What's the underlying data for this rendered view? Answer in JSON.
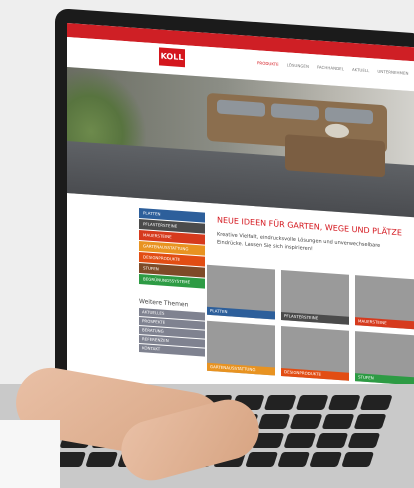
{
  "site": {
    "logo_text": "KOLL",
    "nav": [
      "PRODUKTE",
      "LÖSUNGEN",
      "FACHHANDEL",
      "AKTUELL",
      "UNTERNEHMEN"
    ],
    "active_nav_index": 0,
    "colors": {
      "brand": "#d4161d",
      "topbar": "#cf1f25",
      "sidebar_muted": "#7f8290"
    }
  },
  "sidebar": {
    "items": [
      {
        "label": "PLATTEN",
        "color": "#2d5f9b"
      },
      {
        "label": "PFLASTERSTEINE",
        "color": "#4b4b4b"
      },
      {
        "label": "MAUERSTEINE",
        "color": "#d63a1d"
      },
      {
        "label": "GARTENAUSSTATTUNG",
        "color": "#e89321"
      },
      {
        "label": "DESIGNPRODUKTE",
        "color": "#e24d13"
      },
      {
        "label": "STUFEN",
        "color": "#7e4a27"
      },
      {
        "label": "BEGRÜNUNGSSYSTEME",
        "color": "#2d9b44"
      }
    ]
  },
  "content": {
    "title": "NEUE IDEEN FÜR GARTEN, WEGE UND PLÄTZE",
    "intro": "Kreative Vielfalt, eindrucksvolle Lösungen und unverwechselbare Eindrücke. Lassen Sie sich inspirieren!"
  },
  "cards": [
    {
      "label": "PLATTEN",
      "color": "#2d5f9b"
    },
    {
      "label": "PFLASTERSTEINE",
      "color": "#4b4b4b"
    },
    {
      "label": "MAUERSTEINE",
      "color": "#d63a1d"
    },
    {
      "label": "GARTENAUSSTATTUNG",
      "color": "#e89321"
    },
    {
      "label": "DESIGNPRODUKTE",
      "color": "#e24d13"
    },
    {
      "label": "STUFEN",
      "color": "#2d9b44"
    }
  ],
  "themes": {
    "title": "Weitere Themen",
    "items": [
      "AKTUELLES",
      "PROSPEKTE",
      "BERATUNG",
      "REFERENZEN",
      "KONTAKT"
    ]
  }
}
